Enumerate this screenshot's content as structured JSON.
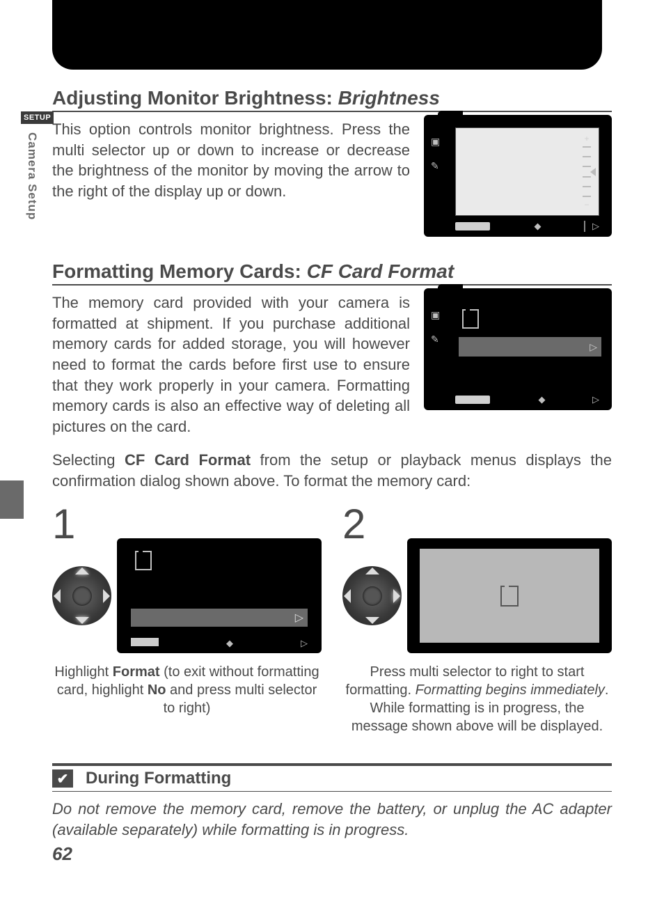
{
  "sidebar": {
    "tag": "SETUP",
    "vertical_label": "Camera Setup"
  },
  "section1": {
    "title_prefix": "Adjusting Monitor Brightness: ",
    "title_italic": "Brightness",
    "body": "This option controls monitor brightness.  Press the multi selector up or down to increase or decrease the brightness of the monitor by moving the arrow to the right of the display up or down."
  },
  "section2": {
    "title_prefix": "Formatting Memory Cards: ",
    "title_italic": "CF Card Format",
    "body": "The memory card provided with your camera is formatted at shipment.  If you purchase additional memory cards for added storage, you will however need to format the cards before first use to ensure that they work properly in your camera.  Formatting memory cards is also an effective way of deleting all pictures on the card.",
    "body2_a": "Selecting ",
    "body2_bold": "CF Card Format",
    "body2_b": " from the setup or playback menus displays the confirmation dialog shown above.  To format the memory card:"
  },
  "steps": {
    "one": {
      "num": "1",
      "cap_a": "Highlight ",
      "cap_bold1": "Format",
      "cap_b": " (to exit without formatting card, highlight ",
      "cap_bold2": "No",
      "cap_c": " and press multi selector to right)"
    },
    "two": {
      "num": "2",
      "cap_a": "Press multi selector to right to start formatting.  ",
      "cap_italic": "Formatting begins immediately",
      "cap_b": ".  While formatting is in progress, the message shown above will be displayed."
    }
  },
  "warning": {
    "title": "During Formatting",
    "body": "Do not remove the memory card, remove the battery, or unplug the AC adapter (available separately) while formatting is in progress."
  },
  "page_number": "62",
  "icons": {
    "plus": "+",
    "minus": "−",
    "updown": "◆",
    "tri_right": "▷",
    "check": "✔"
  }
}
